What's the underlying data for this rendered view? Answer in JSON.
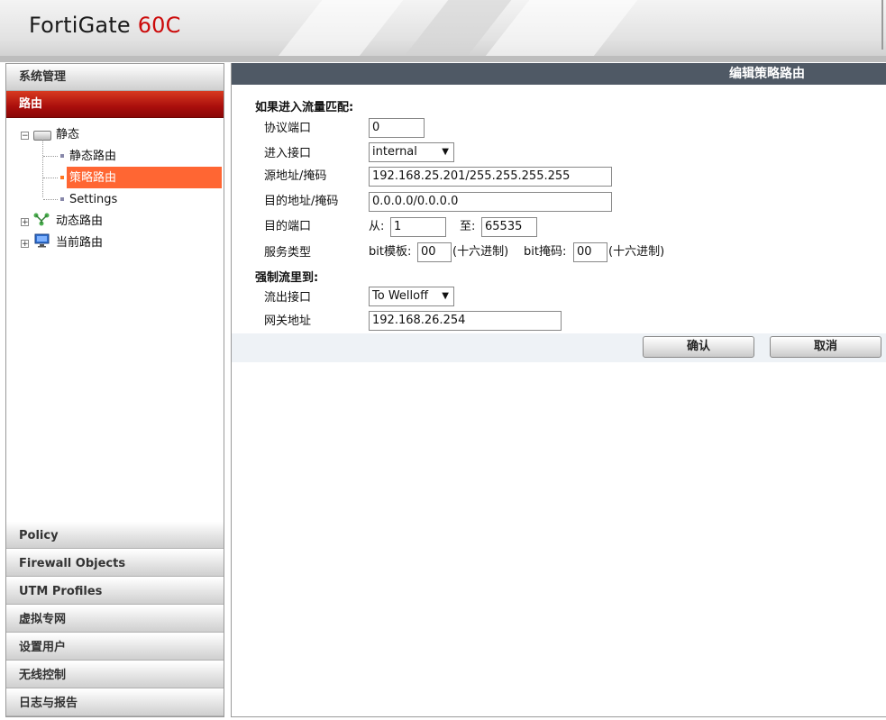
{
  "header": {
    "brand_main": "FortiGate ",
    "brand_model": "60C"
  },
  "sidebar": {
    "top_sections": [
      "系统管理",
      "路由"
    ],
    "tree": {
      "static": "静态",
      "static_route": "静态路由",
      "policy_route": "策略路由",
      "settings": "Settings",
      "dynamic_route": "动态路由",
      "current_route": "当前路由"
    },
    "bottom_sections": [
      "Policy",
      "Firewall Objects",
      "UTM Profiles",
      "虚拟专网",
      "设置用户",
      "无线控制",
      "日志与报告"
    ]
  },
  "main": {
    "title": "编辑策略路由",
    "match_section": "如果进入流量匹配:",
    "protocol_label": "协议端口",
    "protocol_value": "0",
    "incoming_label": "进入接口",
    "incoming_value": "internal",
    "src_label": "源地址/掩码",
    "src_value": "192.168.25.201/255.255.255.255",
    "dst_label": "目的地址/掩码",
    "dst_value": "0.0.0.0/0.0.0.0",
    "port_label": "目的端口",
    "from_label": "从:",
    "from_value": "1",
    "to_label": "至:",
    "to_value": "65535",
    "tos_label": "服务类型",
    "bit_mask_label": "bit模板:",
    "bit_mask_value": "00",
    "hex1": "(十六进制)",
    "bit_code_label": "bit掩码:",
    "bit_code_value": "00",
    "hex2": "(十六进制)",
    "force_section": "强制流里到:",
    "outgoing_label": "流出接口",
    "outgoing_value": "To Welloff",
    "gateway_label": "网关地址",
    "gateway_value": "192.168.26.254",
    "ok_button": "确认",
    "cancel_button": "取消"
  }
}
